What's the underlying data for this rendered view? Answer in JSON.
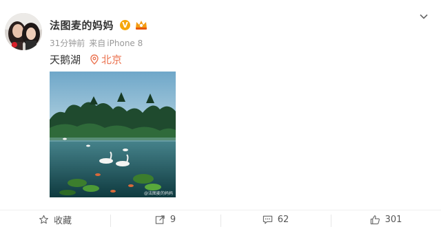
{
  "post": {
    "author_name": "法图麦的妈妈",
    "verified_badge": "V",
    "member_badge_icon": "crown-vip-icon",
    "time_ago": "31分钟前",
    "source_prefix": "来自",
    "device": "iPhone 8",
    "content_text": "天鹅湖",
    "location": "北京",
    "photo_watermark": "@法图麦的妈妈",
    "menu_icon": "chevron-down-icon"
  },
  "actions": {
    "favorite_label": "收藏",
    "repost_count": "9",
    "comment_count": "62",
    "like_count": "301"
  },
  "colors": {
    "accent_orange": "#eb7350",
    "text_primary": "#333333",
    "text_secondary": "#999999",
    "verified_yellow": "#f6a70a"
  }
}
